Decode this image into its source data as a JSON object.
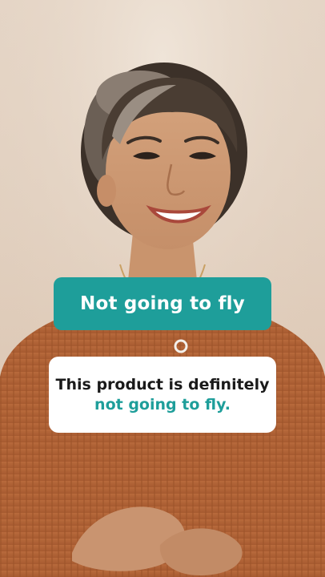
{
  "overlay": {
    "title": "Not going to fly",
    "caption_line1": "This product is definitely",
    "caption_line2": "not going to fly."
  },
  "colors": {
    "accent": "#1e9e9a",
    "caption_bg": "#ffffff",
    "caption_text": "#1a1a1a"
  },
  "scene": {
    "subject_icon": "person-portrait-icon"
  }
}
